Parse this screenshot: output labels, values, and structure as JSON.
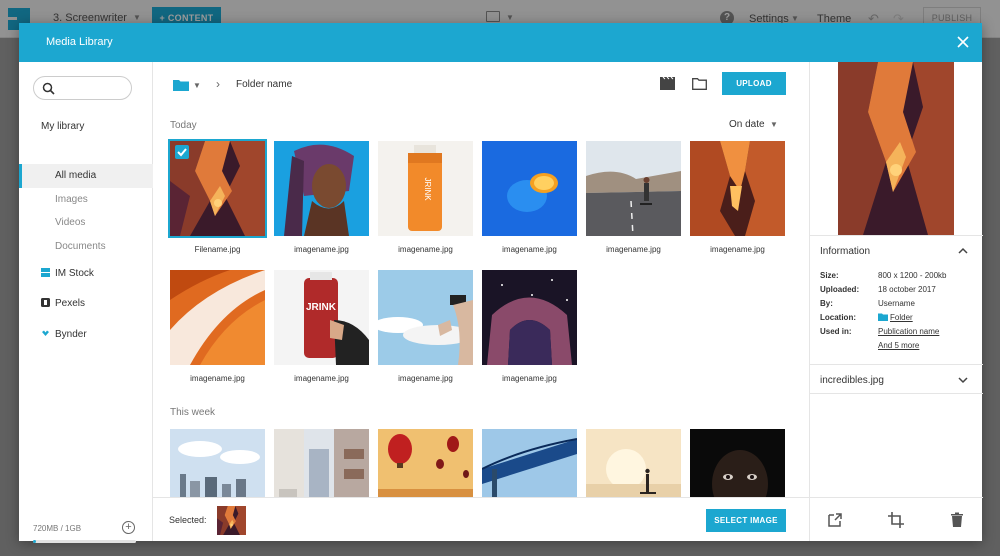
{
  "appbar": {
    "project": "3. Screenwriter",
    "content_button": "CONTENT",
    "settings": "Settings",
    "theme": "Theme",
    "publish": "PUBLISH"
  },
  "modal": {
    "title": "Media Library"
  },
  "sidebar": {
    "search_placeholder": "",
    "library_title": "My library",
    "items": [
      {
        "label": "All media",
        "active": true
      },
      {
        "label": "Images"
      },
      {
        "label": "Videos"
      },
      {
        "label": "Documents"
      }
    ],
    "providers": [
      {
        "label": "IM Stock",
        "icon": "im-stock-icon"
      },
      {
        "label": "Pexels",
        "icon": "pexels-icon"
      },
      {
        "label": "Bynder",
        "icon": "bynder-icon"
      }
    ],
    "storage": {
      "text": "720MB / 1GB",
      "used_fraction": 0.03
    }
  },
  "main": {
    "breadcrumb": "Folder name",
    "upload_button": "UPLOAD",
    "sort_label": "On date",
    "sections": [
      {
        "label": "Today",
        "items": [
          {
            "name": "Filename.jpg",
            "selected": true,
            "thumb": "canyon"
          },
          {
            "name": "imagename.jpg",
            "thumb": "portrait"
          },
          {
            "name": "imagename.jpg",
            "thumb": "juice-bottle"
          },
          {
            "name": "imagename.jpg",
            "thumb": "lemon-blue"
          },
          {
            "name": "imagename.jpg",
            "thumb": "road-skater"
          },
          {
            "name": "imagename.jpg",
            "thumb": "canyon-2"
          },
          {
            "name": "imagename.jpg",
            "thumb": "orange-wave"
          },
          {
            "name": "imagename.jpg",
            "thumb": "juice-hand"
          },
          {
            "name": "imagename.jpg",
            "thumb": "vr-sky"
          },
          {
            "name": "imagename.jpg",
            "thumb": "night-arch"
          }
        ]
      },
      {
        "label": "This week",
        "items": [
          {
            "name": "",
            "thumb": "bridge-city"
          },
          {
            "name": "",
            "thumb": "street"
          },
          {
            "name": "",
            "thumb": "balloons"
          },
          {
            "name": "",
            "thumb": "bridge-blue"
          },
          {
            "name": "",
            "thumb": "paddle"
          },
          {
            "name": "",
            "thumb": "dark-face"
          }
        ]
      }
    ],
    "footer": {
      "selected_label": "Selected:",
      "select_button": "SELECT IMAGE"
    }
  },
  "panel": {
    "info_title": "Information",
    "info": [
      {
        "key": "Size:",
        "value": "800 x 1200 - 200kb"
      },
      {
        "key": "Uploaded:",
        "value": "18 october 2017"
      },
      {
        "key": "By:",
        "value": "Username"
      },
      {
        "key": "Location:",
        "value": "Folder"
      },
      {
        "key": "Used in:",
        "value": "Publication name"
      },
      {
        "key": "",
        "value": "And 5 more"
      }
    ],
    "file_name": "incredibles.jpg"
  },
  "colors": {
    "accent": "#1ca7d0"
  }
}
